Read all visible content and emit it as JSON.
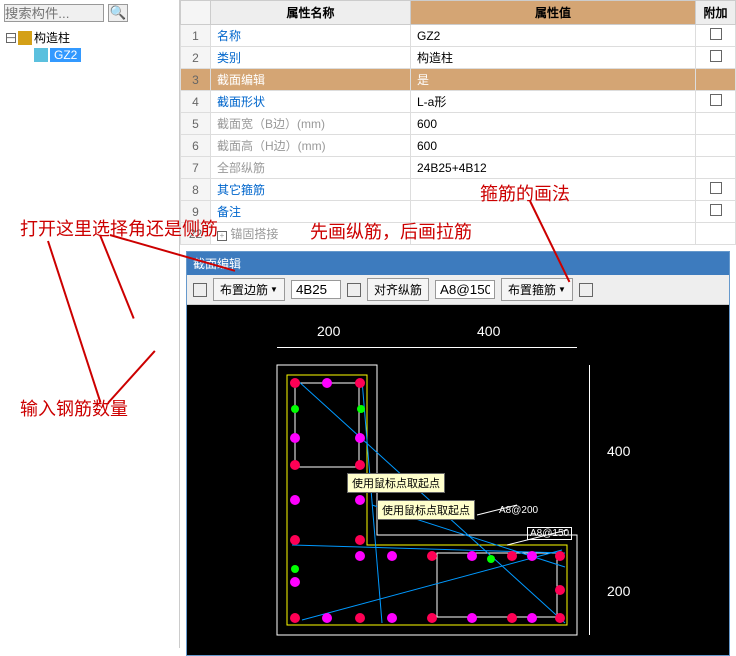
{
  "left": {
    "search_placeholder": "搜索构件...",
    "tree_root": "构造柱",
    "tree_child": "GZ2"
  },
  "prop": {
    "header_name": "属性名称",
    "header_val": "属性值",
    "header_add": "附加",
    "rows": [
      {
        "n": "1",
        "name": "名称",
        "val": "GZ2",
        "cls": "blue-text",
        "add": false
      },
      {
        "n": "2",
        "name": "类别",
        "val": "构造柱",
        "cls": "blue-text",
        "add": true
      },
      {
        "n": "3",
        "name": "截面编辑",
        "val": "是",
        "cls": "",
        "sel": true
      },
      {
        "n": "4",
        "name": "截面形状",
        "val": "L-a形",
        "cls": "blue-text",
        "add": true
      },
      {
        "n": "5",
        "name": "截面宽（B边）(mm)",
        "val": "600",
        "cls": "gray-text"
      },
      {
        "n": "6",
        "name": "截面高（H边）(mm)",
        "val": "600",
        "cls": "gray-text"
      },
      {
        "n": "7",
        "name": "全部纵筋",
        "val": "24B25+4B12",
        "cls": "gray-text"
      },
      {
        "n": "8",
        "name": "其它箍筋",
        "val": "",
        "cls": "blue-text",
        "add": true
      },
      {
        "n": "9",
        "name": "备注",
        "val": "",
        "cls": "blue-text",
        "add": true
      }
    ],
    "last_row": {
      "n": "22",
      "name": "锚固搭接"
    }
  },
  "editor": {
    "title": "截面编辑",
    "layout_edge": "布置边筋",
    "size": "4B25",
    "align": "对齐纵筋",
    "spacing": "A8@150",
    "layout_stirrup": "布置箍筋"
  },
  "canvas": {
    "dim_200": "200",
    "dim_400": "400",
    "dim_400b": "400",
    "dim_200b": "200",
    "tip1": "使用鼠标点取起点",
    "tip2": "使用鼠标点取起点",
    "anno_200": "A8@200",
    "anno_150": "A8@150"
  },
  "annotations": {
    "a1": "打开这里选择角还是侧筋",
    "a2": "先画纵筋，后画拉筋",
    "a3": "箍筋的画法",
    "a4": "输入钢筋数量"
  }
}
